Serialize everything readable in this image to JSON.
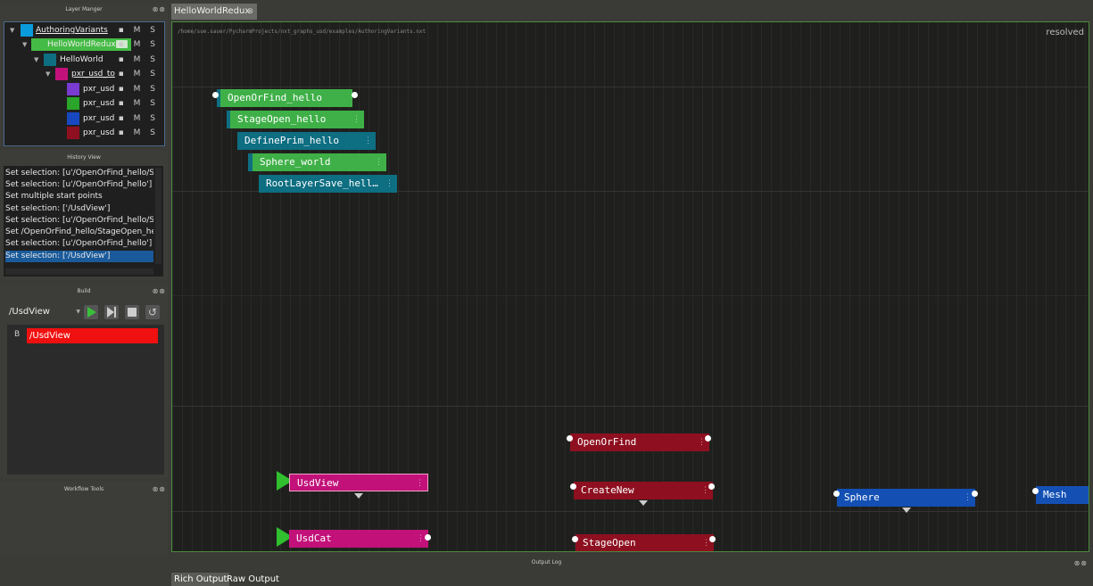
{
  "layer_manager": {
    "title": "Layer Manger",
    "layers": [
      {
        "name": "AuthoringVariants",
        "color": "#0a9bdc"
      },
      {
        "name": "HelloWorldRedux",
        "color": "#44bb44"
      },
      {
        "name": "HelloWorld",
        "color": "#0e6e82"
      },
      {
        "name": "pxr_usd_to",
        "color": "#c2127a"
      },
      {
        "name": "pxr_usd",
        "color": "#7a3bd0"
      },
      {
        "name": "pxr_usd",
        "color": "#2aa52a"
      },
      {
        "name": "pxr_usd",
        "color": "#1848c0"
      },
      {
        "name": "pxr_usd",
        "color": "#8e1020"
      }
    ],
    "col_m": "M",
    "col_s": "S"
  },
  "history": {
    "title": "History View",
    "items": [
      "Set selection: [u'/OpenOrFind_hello/St",
      "Set selection: [u'/OpenOrFind_hello']",
      "Set multiple start points",
      "Set selection: ['/UsdView']",
      "Set selection: [u'/OpenOrFind_hello/St",
      "Set /OpenOrFind_hello/StageOpen_he",
      "Set selection: [u'/OpenOrFind_hello']",
      "Set selection: ['/UsdView']"
    ]
  },
  "build": {
    "title": "Build",
    "target": "/UsdView",
    "item_flag": "B",
    "item_label": "/UsdView"
  },
  "workflow": {
    "title": "Workflow Tools"
  },
  "tab": {
    "label": "HelloWorldRedux"
  },
  "canvas": {
    "path": "/home/sue.sauer/PycharmProjects/nxt_graphs_usd/examples/AuthoringVariants.nxt",
    "status": "resolved",
    "nodes": {
      "openorfind_hello": "OpenOrFind_hello",
      "stageopen_hello": "StageOpen_hello",
      "defineprim_hello": "DefinePrim_hello",
      "sphere_world": "Sphere_world",
      "rootlayersave": "RootLayerSave_hell…",
      "openorfind": "OpenOrFind",
      "usdview": "UsdView",
      "createnew": "CreateNew",
      "sphere": "Sphere",
      "mesh": "Mesh",
      "usdcat": "UsdCat",
      "stageopen": "StageOpen"
    }
  },
  "output": {
    "title": "Output Log",
    "tabs": [
      "Rich Output",
      "Raw Output"
    ]
  }
}
